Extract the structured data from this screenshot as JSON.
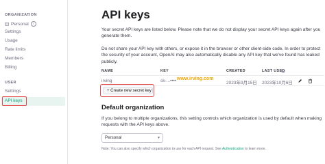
{
  "sidebar": {
    "org_heading": "ORGANIZATION",
    "org_name": "Personal",
    "org_items": [
      "Settings",
      "Usage",
      "Rate limits",
      "Members",
      "Billing"
    ],
    "user_heading": "USER",
    "user_items": [
      "Settings",
      "API keys"
    ],
    "active_item": "API keys",
    "accent_color": "#10a37f",
    "highlight_color": "#e0484a"
  },
  "main": {
    "title": "API keys",
    "para1": "Your secret API keys are listed below. Please note that we do not display your secret API keys again after you generate them.",
    "para2": "Do not share your API key with others, or expose it in the browser or other client-side code. In order to protect the security of your account, OpenAI may also automatically disable any API key that we've found has leaked publicly.",
    "table": {
      "headers": [
        "NAME",
        "KEY",
        "CREATED",
        "LAST USED"
      ],
      "rows": [
        {
          "name": "irving",
          "key": "sk-...••••",
          "created": "2023年9月15日",
          "last_used": "2023年10月6日"
        }
      ]
    },
    "watermark": "www.irving.com",
    "create_button": "+ Create new secret key",
    "default_org_title": "Default organization",
    "default_org_text": "If you belong to multiple organizations, this setting controls which organization is used by default when making requests with the API keys above.",
    "org_select": "Personal",
    "note_prefix": "Note: You can also specify which organization to use for each API request. See",
    "note_link": "Authentication",
    "note_suffix": "to learn more."
  }
}
